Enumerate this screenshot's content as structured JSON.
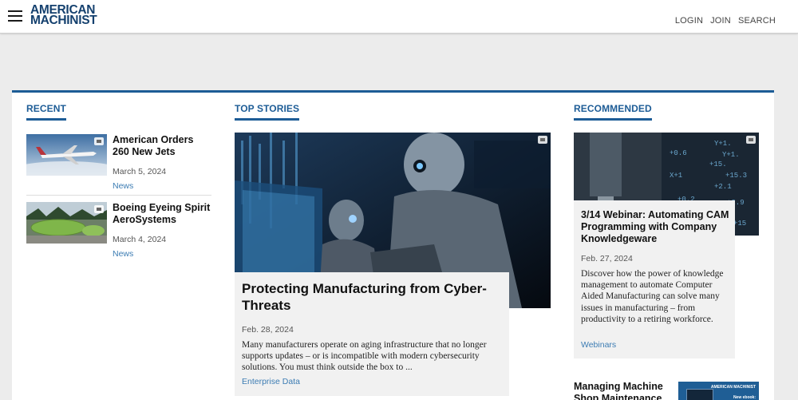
{
  "header": {
    "logo_line1": "AMERICAN",
    "logo_line2": "MACHINIST",
    "nav": [
      "LOGIN",
      "JOIN",
      "SEARCH"
    ]
  },
  "sections": {
    "recent": "RECENT",
    "top_stories": "TOP STORIES",
    "recommended": "RECOMMENDED"
  },
  "recent": [
    {
      "title": "American Orders 260 New Jets",
      "date": "March 5, 2024",
      "category": "News"
    },
    {
      "title": "Boeing Eyeing Spirit AeroSystems",
      "date": "March 4, 2024",
      "category": "News"
    }
  ],
  "top_story": {
    "headline": "Protecting Manufacturing from Cyber-Threats",
    "date": "Feb. 28, 2024",
    "summary": "Many manufacturers operate on aging infrastructure that no longer supports updates – or is incompatible with modern cybersecurity solutions. You must think outside the box to ...",
    "category": "Enterprise Data"
  },
  "recommended": [
    {
      "headline": "3/14 Webinar: Automating CAM Programming with Company Knowledgeware",
      "date": "Feb. 27, 2024",
      "summary": "Discover how the power of knowledge management to automate Computer Aided Manufacturing can solve many issues in manufacturing – from productivity to a retiring workforce.",
      "category": "Webinars"
    },
    {
      "headline": "Managing Machine Shop Maintenance",
      "thumb_text1": "AMERICAN MACHINIST",
      "thumb_text2": "New ebook:"
    }
  ],
  "colors": {
    "brand_blue": "#1d5c96",
    "link_blue": "#3c7cb3",
    "logo_blue": "#14406e"
  }
}
